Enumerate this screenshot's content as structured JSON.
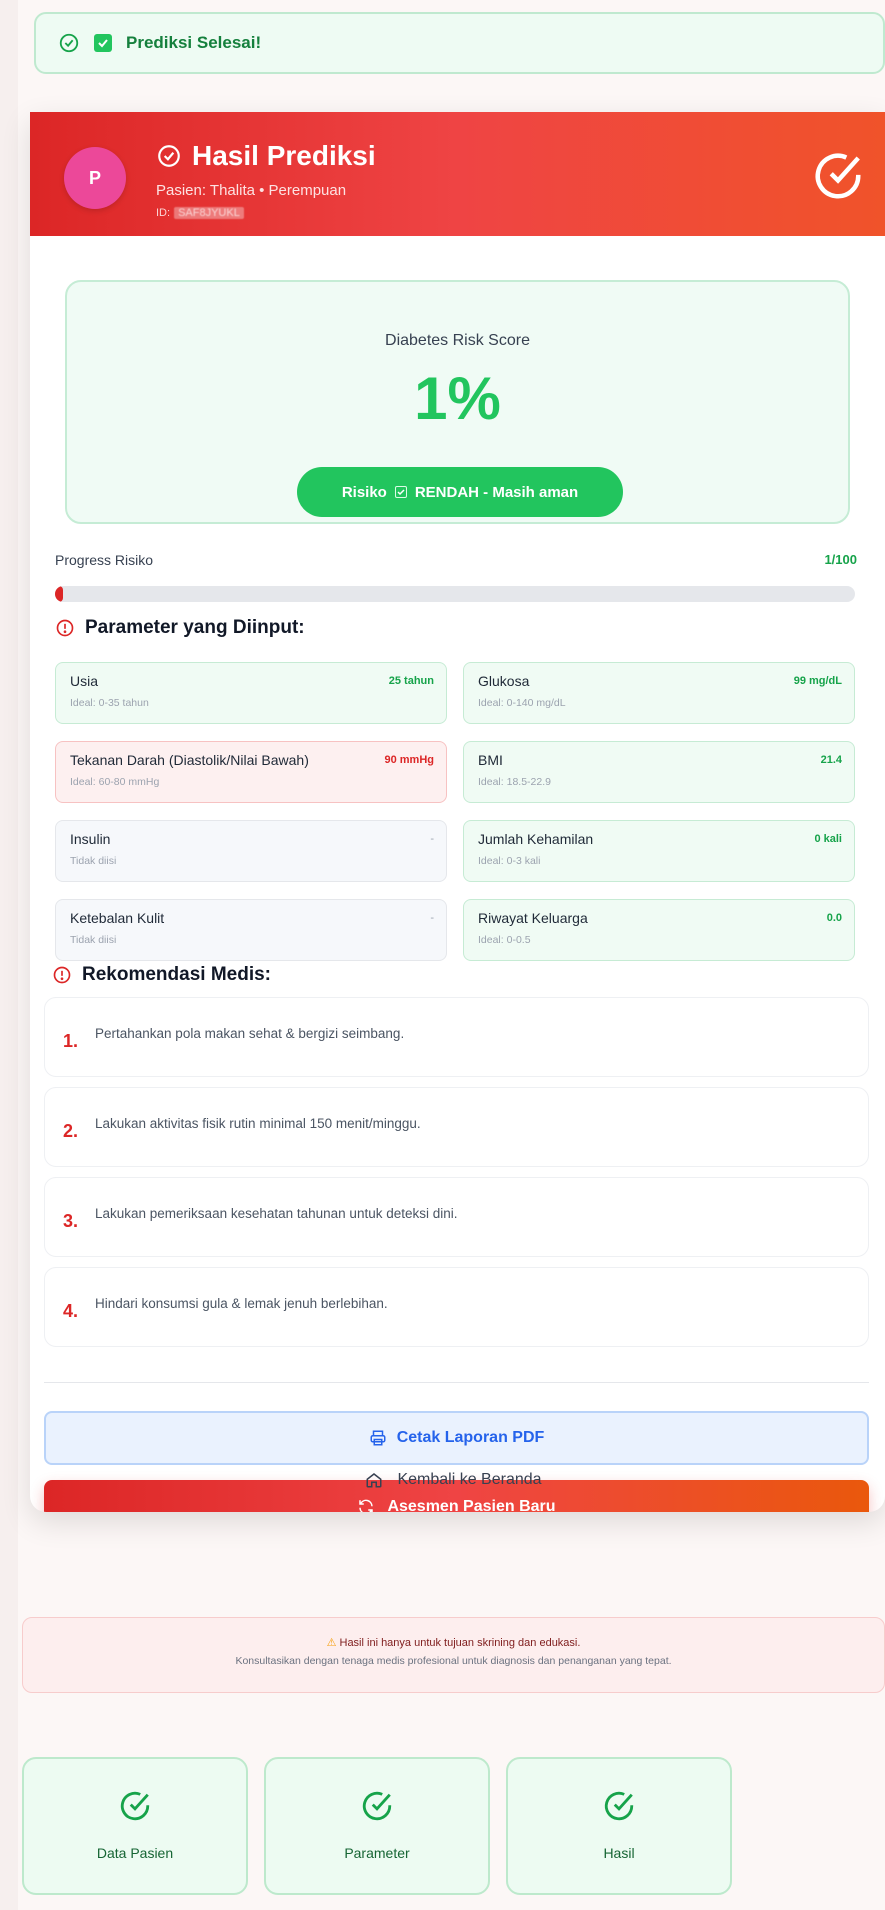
{
  "toast": {
    "text": "Prediksi Selesai!"
  },
  "header": {
    "avatar_letter": "P",
    "title": "Hasil Prediksi",
    "patient_line": "Pasien: Thalita • Perempuan",
    "id_label": "ID:",
    "id_value": "SAF8JYUKL"
  },
  "score": {
    "label": "Diabetes Risk Score",
    "value": "1%",
    "risk_prefix": "Risiko",
    "risk_text": "RENDAH - Masih aman"
  },
  "progress": {
    "label": "Progress Risiko",
    "value_text": "1/100",
    "fraction": 0.01
  },
  "parameters": {
    "title": "Parameter yang Diinput:",
    "items": [
      {
        "name": "Usia",
        "value": "25 tahun",
        "ideal": "Ideal: 0-35 tahun",
        "status": "good"
      },
      {
        "name": "Glukosa",
        "value": "99 mg/dL",
        "ideal": "Ideal: 0-140 mg/dL",
        "status": "good"
      },
      {
        "name": "Tekanan Darah (Diastolik/Nilai Bawah)",
        "value": "90 mmHg",
        "ideal": "Ideal: 60-80 mmHg",
        "status": "bad"
      },
      {
        "name": "BMI",
        "value": "21.4",
        "ideal": "Ideal: 18.5-22.9",
        "status": "good"
      },
      {
        "name": "Insulin",
        "value": "-",
        "ideal": "Tidak diisi",
        "status": "empty"
      },
      {
        "name": "Jumlah Kehamilan",
        "value": "0 kali",
        "ideal": "Ideal: 0-3 kali",
        "status": "good"
      },
      {
        "name": "Ketebalan Kulit",
        "value": "-",
        "ideal": "Tidak diisi",
        "status": "empty"
      },
      {
        "name": "Riwayat Keluarga",
        "value": "0.0",
        "ideal": "Ideal: 0-0.5",
        "status": "good"
      }
    ]
  },
  "recommendations": {
    "title": "Rekomendasi Medis:",
    "items": [
      {
        "num": "1.",
        "text": "Pertahankan pola makan sehat & bergizi seimbang."
      },
      {
        "num": "2.",
        "text": "Lakukan aktivitas fisik rutin minimal 150 menit/minggu."
      },
      {
        "num": "3.",
        "text": "Lakukan pemeriksaan kesehatan tahunan untuk deteksi dini."
      },
      {
        "num": "4.",
        "text": "Hindari konsumsi gula & lemak jenuh berlebihan."
      }
    ]
  },
  "actions": {
    "print_label": "Cetak Laporan PDF",
    "new_label": "Asesmen Pasien Baru",
    "home_label": "Kembali ke Beranda"
  },
  "disclaimer": {
    "line1": "Hasil ini hanya untuk tujuan skrining dan edukasi.",
    "line2": "Konsultasikan dengan tenaga medis profesional untuk diagnosis dan penanganan yang tepat."
  },
  "steps": [
    {
      "label": "Data Pasien"
    },
    {
      "label": "Parameter"
    },
    {
      "label": "Hasil"
    }
  ],
  "colors": {
    "success": "#22c55e",
    "danger": "#dc2626",
    "info": "#2563eb"
  }
}
